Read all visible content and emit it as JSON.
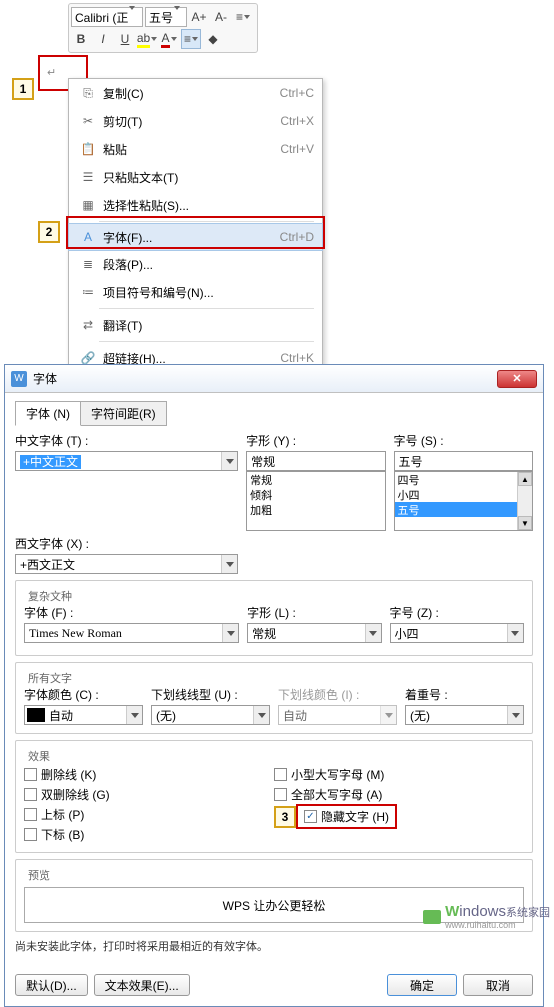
{
  "toolbar": {
    "font_name": "Calibri (正",
    "font_size": "五号"
  },
  "markers": {
    "m1": "1",
    "m2": "2",
    "m3": "3"
  },
  "context_menu": {
    "copy": {
      "label": "复制(C)",
      "shortcut": "Ctrl+C"
    },
    "cut": {
      "label": "剪切(T)",
      "shortcut": "Ctrl+X"
    },
    "paste": {
      "label": "粘贴",
      "shortcut": "Ctrl+V"
    },
    "paste_text": {
      "label": "只粘贴文本(T)",
      "shortcut": ""
    },
    "paste_special": {
      "label": "选择性粘贴(S)...",
      "shortcut": ""
    },
    "font": {
      "label": "字体(F)...",
      "shortcut": "Ctrl+D"
    },
    "paragraph": {
      "label": "段落(P)...",
      "shortcut": ""
    },
    "numbering": {
      "label": "项目符号和编号(N)...",
      "shortcut": ""
    },
    "translate": {
      "label": "翻译(T)",
      "shortcut": ""
    },
    "hyperlink": {
      "label": "超链接(H)...",
      "shortcut": "Ctrl+K"
    }
  },
  "dialog": {
    "title": "字体",
    "tab_font": "字体 (N)",
    "tab_spacing": "字符间距(R)",
    "cn_font_label": "中文字体 (T) :",
    "cn_font_value": "+中文正文",
    "style_label": "字形 (Y) :",
    "style_value": "常规",
    "style_opts": {
      "o1": "常规",
      "o2": "倾斜",
      "o3": "加粗"
    },
    "size_label": "字号 (S) :",
    "size_value": "五号",
    "size_opts": {
      "o1": "四号",
      "o2": "小四",
      "o3": "五号"
    },
    "en_font_label": "西文字体 (X) :",
    "en_font_value": "+西文正文",
    "complex_legend": "复杂文种",
    "cx_font_label": "字体 (F) :",
    "cx_font_value": "Times New Roman",
    "cx_style_label": "字形 (L) :",
    "cx_style_value": "常规",
    "cx_size_label": "字号 (Z) :",
    "cx_size_value": "小四",
    "allchars_legend": "所有文字",
    "color_label": "字体颜色 (C) :",
    "color_value": "自动",
    "underline_label": "下划线线型 (U) :",
    "underline_value": "(无)",
    "ulcolor_label": "下划线颜色 (I) :",
    "ulcolor_value": "自动",
    "emphasis_label": "着重号 :",
    "emphasis_value": "(无)",
    "effects_legend": "效果",
    "strike": "删除线 (K)",
    "dblstrike": "双删除线 (G)",
    "superscript": "上标 (P)",
    "subscript": "下标 (B)",
    "smallcaps": "小型大写字母 (M)",
    "allcaps": "全部大写字母 (A)",
    "hidden": "隐藏文字 (H)",
    "preview_legend": "预览",
    "preview_text": "WPS 让办公更轻松",
    "note_text": "尚未安装此字体，打印时将采用最相近的有效字体。",
    "default_btn": "默认(D)...",
    "texteffect_btn": "文本效果(E)...",
    "ok_btn": "确定",
    "cancel_btn": "取消"
  },
  "watermark": {
    "brand": "indows",
    "sub": "www.ruihaitu.com",
    "w": "W",
    "suffix": "系统家园"
  }
}
